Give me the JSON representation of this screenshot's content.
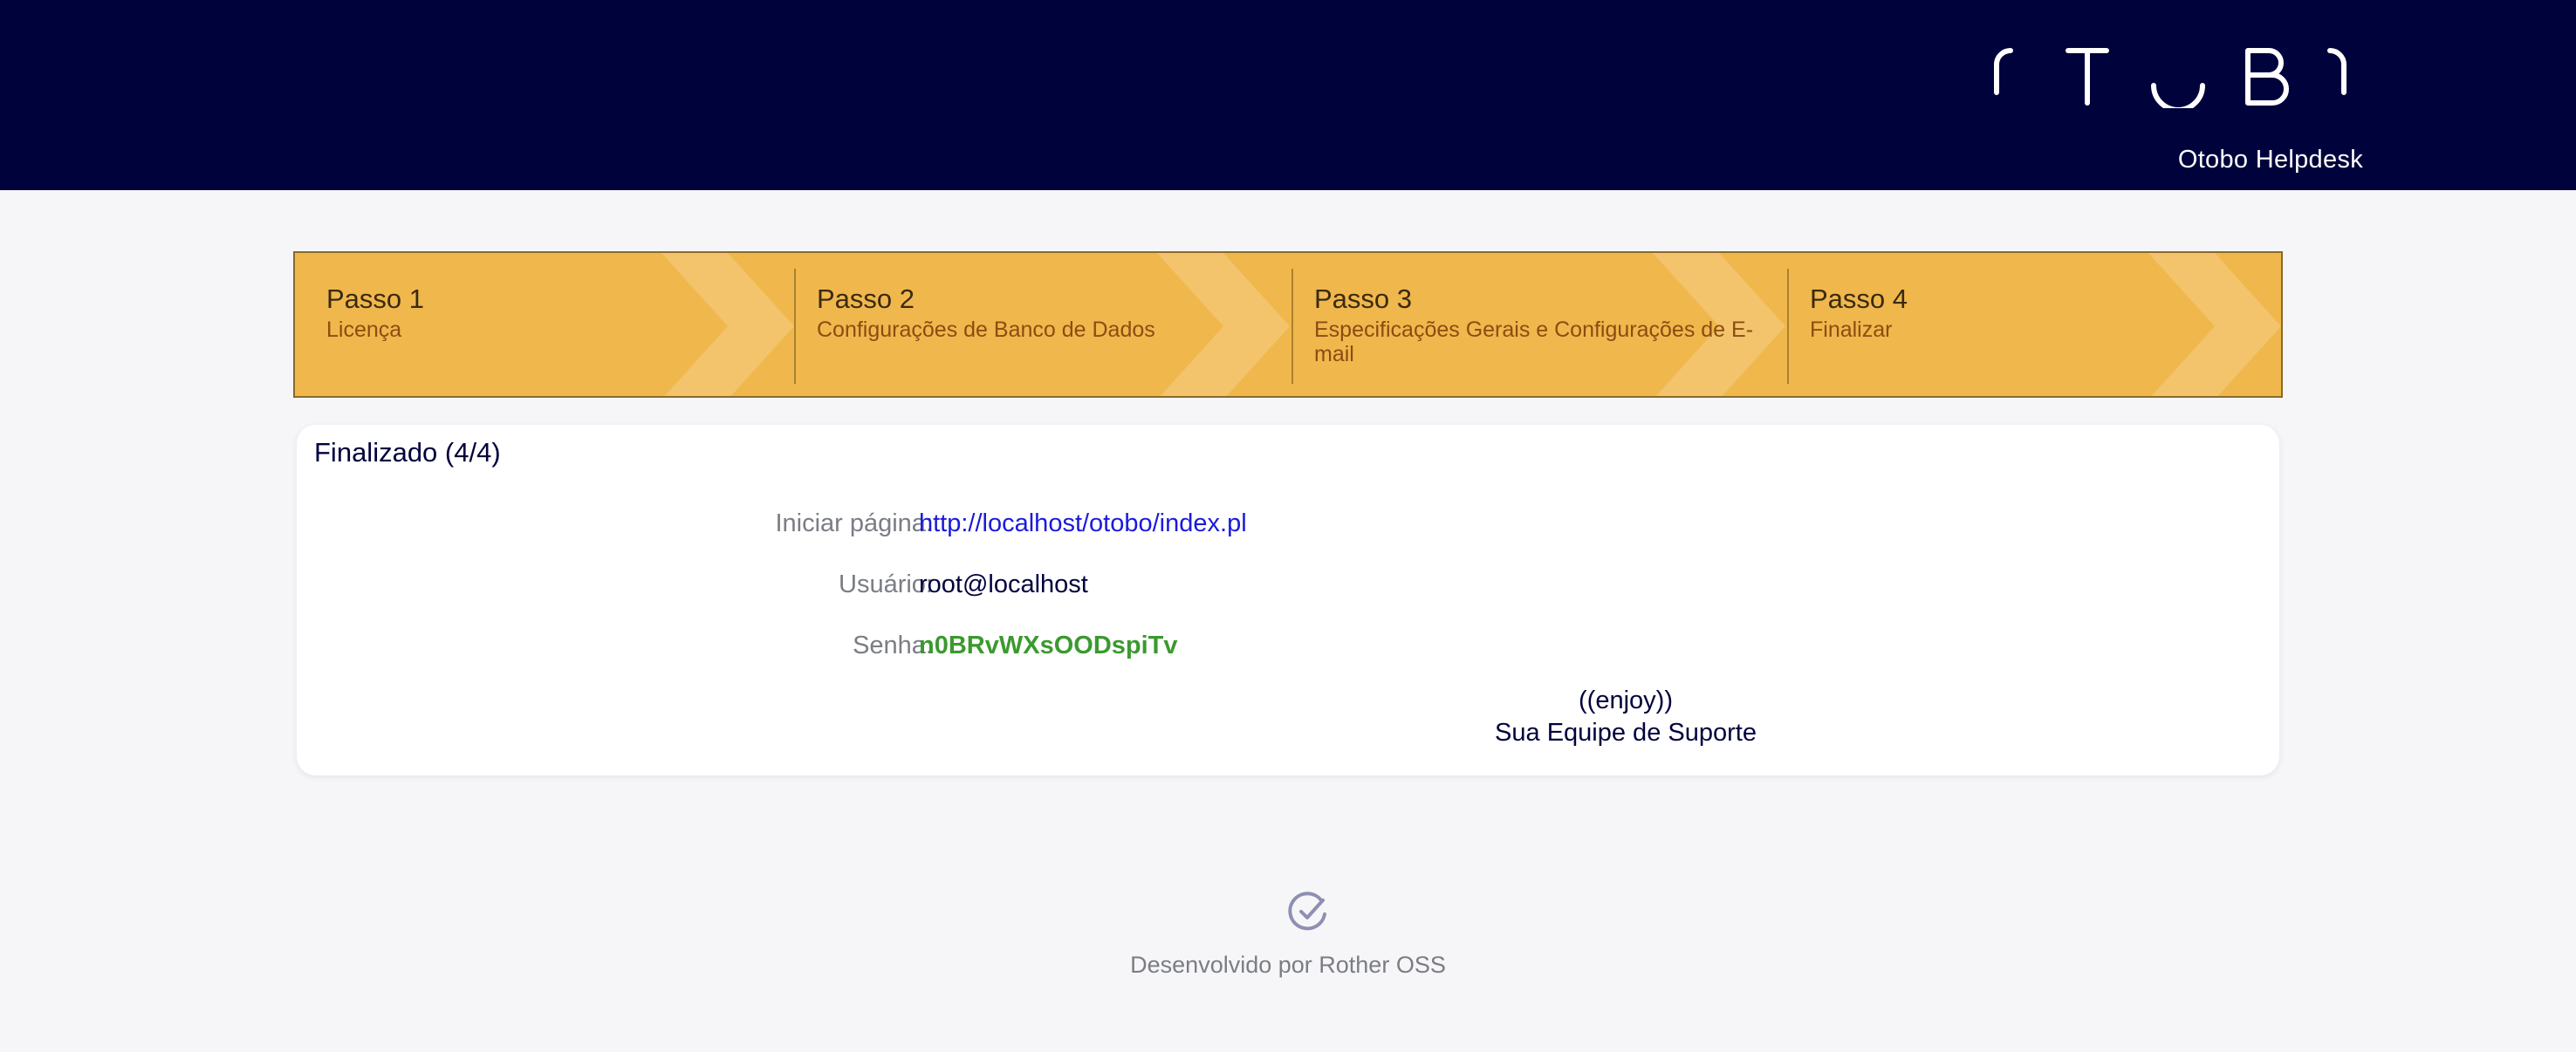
{
  "header": {
    "logo_text": "OTOBO",
    "subtitle": "Otobo Helpdesk"
  },
  "steps": [
    {
      "title": "Passo 1",
      "desc": "Licença"
    },
    {
      "title": "Passo 2",
      "desc": "Configurações de Banco de Dados"
    },
    {
      "title": "Passo 3",
      "desc": "Especificações Gerais e Configurações de E-mail"
    },
    {
      "title": "Passo 4",
      "desc": "Finalizar"
    }
  ],
  "panel": {
    "title": "Finalizado (4/4)",
    "rows": [
      {
        "label": "Iniciar página:",
        "value": "http://localhost/otobo/index.pl"
      },
      {
        "label": "Usuário:",
        "value": "root@localhost"
      },
      {
        "label": "Senha:",
        "value": "n0BRvWXsOODspiTv"
      }
    ],
    "closing_line1": "((enjoy))",
    "closing_line2": "Sua Equipe de Suporte"
  },
  "footer": {
    "icon": "check-circle-icon",
    "text": "Desenvolvido por Rother OSS"
  },
  "colors": {
    "header_bg": "#00023c",
    "steps_bg": "#f0b74c",
    "link": "#1a1adc",
    "password": "#3a9a2f"
  }
}
